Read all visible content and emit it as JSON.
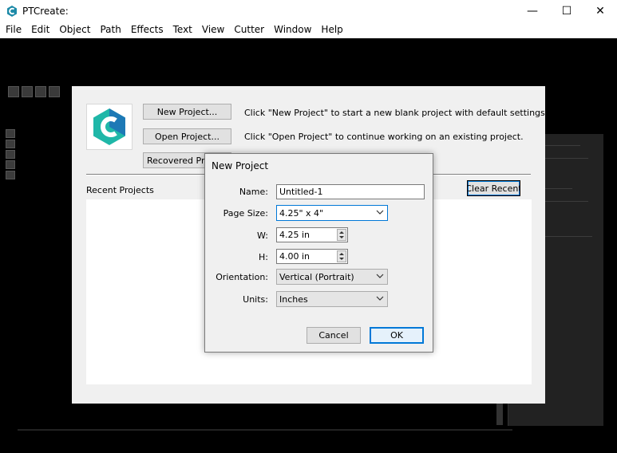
{
  "window": {
    "title": "PTCreate:",
    "minimize_glyph": "—",
    "maximize_glyph": "☐",
    "close_glyph": "✕"
  },
  "menu": [
    "File",
    "Edit",
    "Object",
    "Path",
    "Effects",
    "Text",
    "View",
    "Cutter",
    "Window",
    "Help"
  ],
  "start_dialog": {
    "new_project_button": "New Project...",
    "new_project_hint": "Click \"New Project\" to start a new blank project with default settings.",
    "open_project_button": "Open Project...",
    "open_project_hint": "Click \"Open Project\" to continue working on an existing project.",
    "recovered_projects_button": "Recovered Projects",
    "recent_projects_label": "Recent Projects",
    "clear_recent_button": "Clear Recent"
  },
  "new_project": {
    "title": "New Project",
    "name_label": "Name:",
    "name_value": "Untitled-1",
    "page_size_label": "Page Size:",
    "page_size_value": "4.25\" x 4\"",
    "width_label": "W:",
    "width_value": "4.25 in",
    "height_label": "H:",
    "height_value": "4.00 in",
    "orientation_label": "Orientation:",
    "orientation_value": "Vertical (Portrait)",
    "units_label": "Units:",
    "units_value": "Inches",
    "cancel_button": "Cancel",
    "ok_button": "OK"
  },
  "colors": {
    "workspace": "#000000",
    "dialog": "#f0f0f0",
    "accent": "#0078d7",
    "logo_teal": "#1fb7a8",
    "logo_blue": "#1d6fb8"
  },
  "icons": {
    "app": "app-logo-icon",
    "dropdown": "chevron-down-icon",
    "spinner": "spinner-arrows-icon"
  }
}
